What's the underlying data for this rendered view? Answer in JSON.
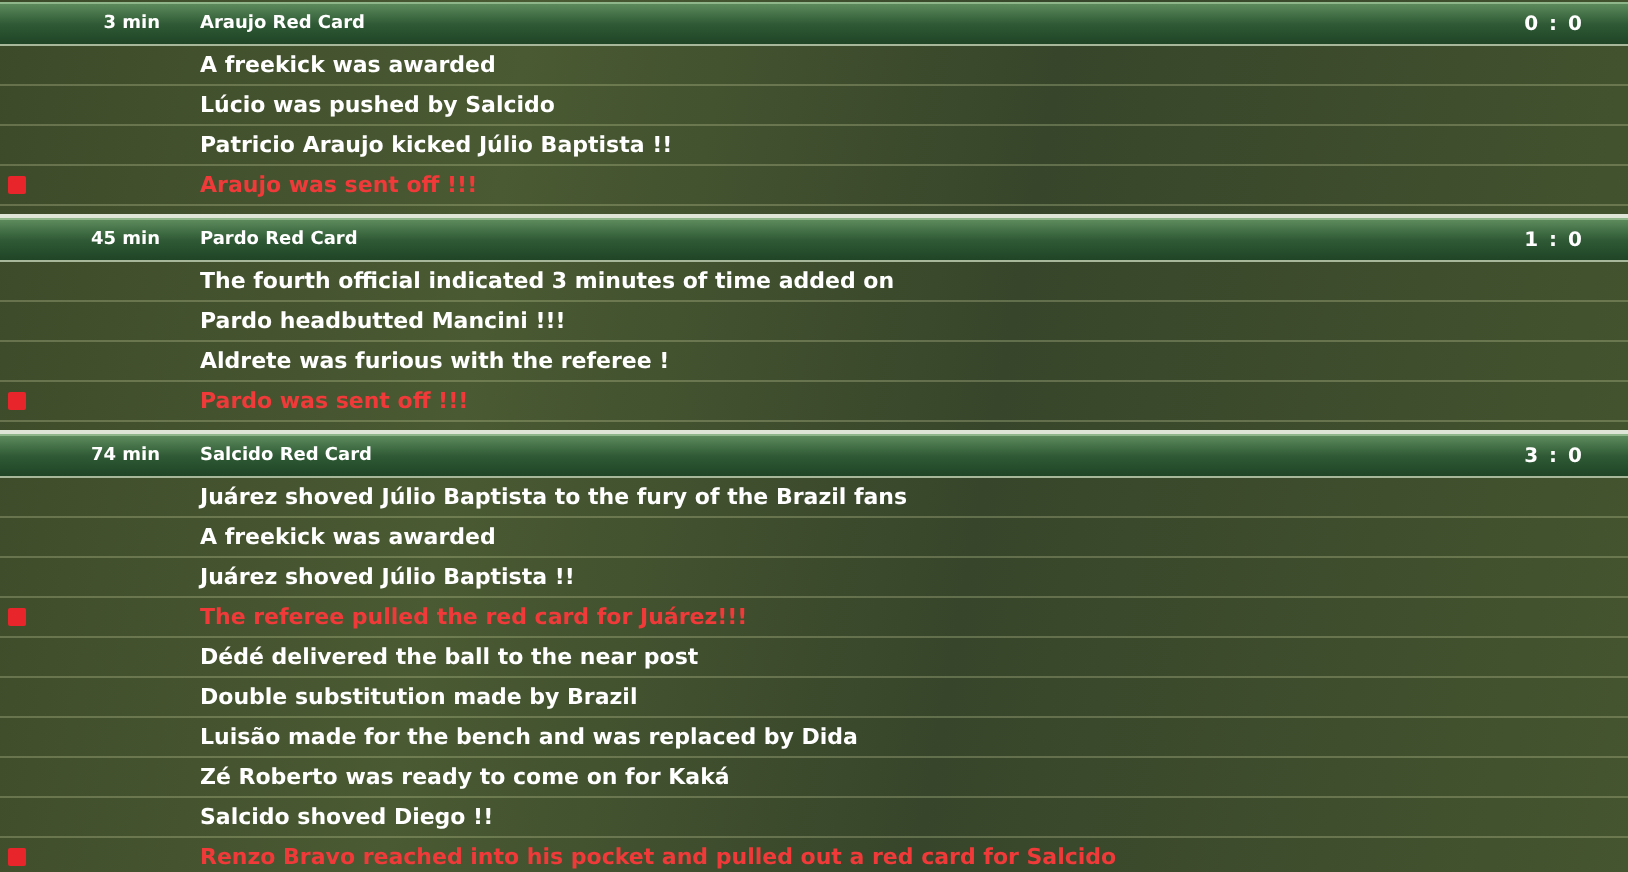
{
  "incidents": [
    {
      "minute": "3 min",
      "title": "Araujo Red Card",
      "score": "0 : 0",
      "events": [
        {
          "kind": "event",
          "text": "A freekick was awarded"
        },
        {
          "kind": "event",
          "text": "Lúcio was pushed by Salcido"
        },
        {
          "kind": "event",
          "text": "Patricio Araujo kicked Júlio Baptista !!"
        },
        {
          "kind": "red_card",
          "text": "Araujo was sent off !!!"
        }
      ]
    },
    {
      "minute": "45 min",
      "title": "Pardo Red Card",
      "score": "1 : 0",
      "events": [
        {
          "kind": "event",
          "text": "The fourth official indicated 3 minutes of time added on"
        },
        {
          "kind": "event",
          "text": "Pardo headbutted Mancini !!!"
        },
        {
          "kind": "event",
          "text": "Aldrete was furious with the referee !"
        },
        {
          "kind": "red_card",
          "text": "Pardo was sent off !!!"
        }
      ]
    },
    {
      "minute": "74 min",
      "title": "Salcido Red Card",
      "score": "3 : 0",
      "events": [
        {
          "kind": "event",
          "text": "Juárez shoved Júlio Baptista to the fury of the Brazil fans"
        },
        {
          "kind": "event",
          "text": "A freekick was awarded"
        },
        {
          "kind": "event",
          "text": "Juárez shoved Júlio Baptista !!"
        },
        {
          "kind": "red_card",
          "text": "The referee pulled the red card for Juárez!!!"
        },
        {
          "kind": "event",
          "text": "Dédé delivered the ball to the near post"
        },
        {
          "kind": "event",
          "text": "Double substitution made by Brazil"
        },
        {
          "kind": "event",
          "text": "Luisão made for the bench and was replaced by Dida"
        },
        {
          "kind": "event",
          "text": "Zé Roberto was ready to come on for Kaká"
        },
        {
          "kind": "event",
          "text": "Salcido shoved Diego !!"
        },
        {
          "kind": "red_card",
          "text": "Renzo Bravo reached into his pocket and pulled out a red card for Salcido"
        }
      ]
    }
  ]
}
